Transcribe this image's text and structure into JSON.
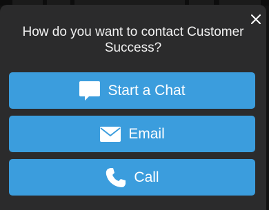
{
  "dialog": {
    "title": "How do you want to contact Customer Success?",
    "close_icon": "close-icon"
  },
  "options": [
    {
      "label": "Start a Chat",
      "icon": "chat-bubble-icon"
    },
    {
      "label": "Email",
      "icon": "envelope-icon"
    },
    {
      "label": "Call",
      "icon": "phone-icon"
    }
  ],
  "colors": {
    "sheet_background": "#2b2b2c",
    "button_accent": "#3b9ddd",
    "text": "#ffffff"
  }
}
